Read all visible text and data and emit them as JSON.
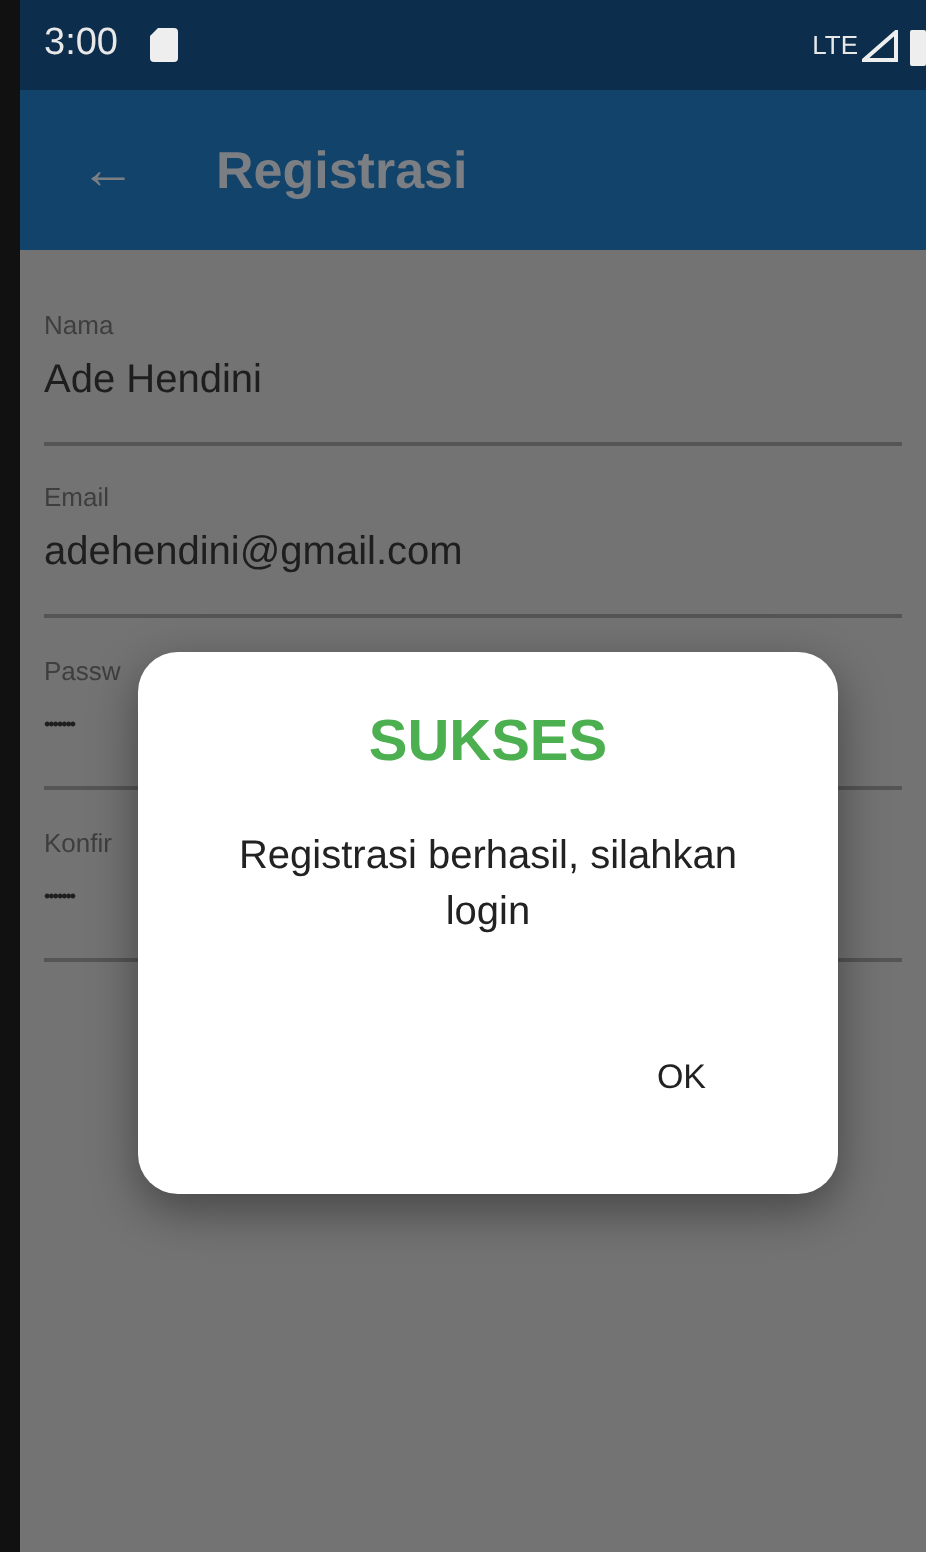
{
  "status_bar": {
    "time": "3:00",
    "network": "LTE"
  },
  "app_bar": {
    "back_icon": "←",
    "title": "Registrasi"
  },
  "form": {
    "fields": [
      {
        "label": "Nama",
        "value": "Ade Hendini"
      },
      {
        "label": "Email",
        "value": "adehendini@gmail.com"
      },
      {
        "label": "Passw",
        "value": "•••••••"
      },
      {
        "label": "Konfir",
        "value": "•••••••"
      }
    ]
  },
  "dialog": {
    "title": "SUKSES",
    "message": "Registrasi berhasil, silahkan login",
    "buttons": [
      "OK"
    ]
  }
}
